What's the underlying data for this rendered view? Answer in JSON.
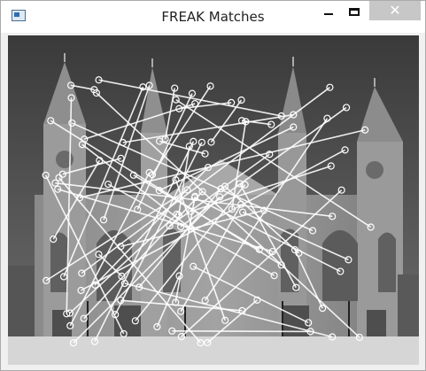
{
  "window": {
    "title": "FREAK Matches",
    "icon": "app-window-icon",
    "controls": {
      "minimize": "minimize-icon",
      "maximize": "maximize-icon",
      "close_glyph": "✕"
    }
  },
  "image": {
    "description_kind": "grayscale photo of cathedral with feature-match overlay",
    "match_color": "#ffffff",
    "match_count": 64
  }
}
